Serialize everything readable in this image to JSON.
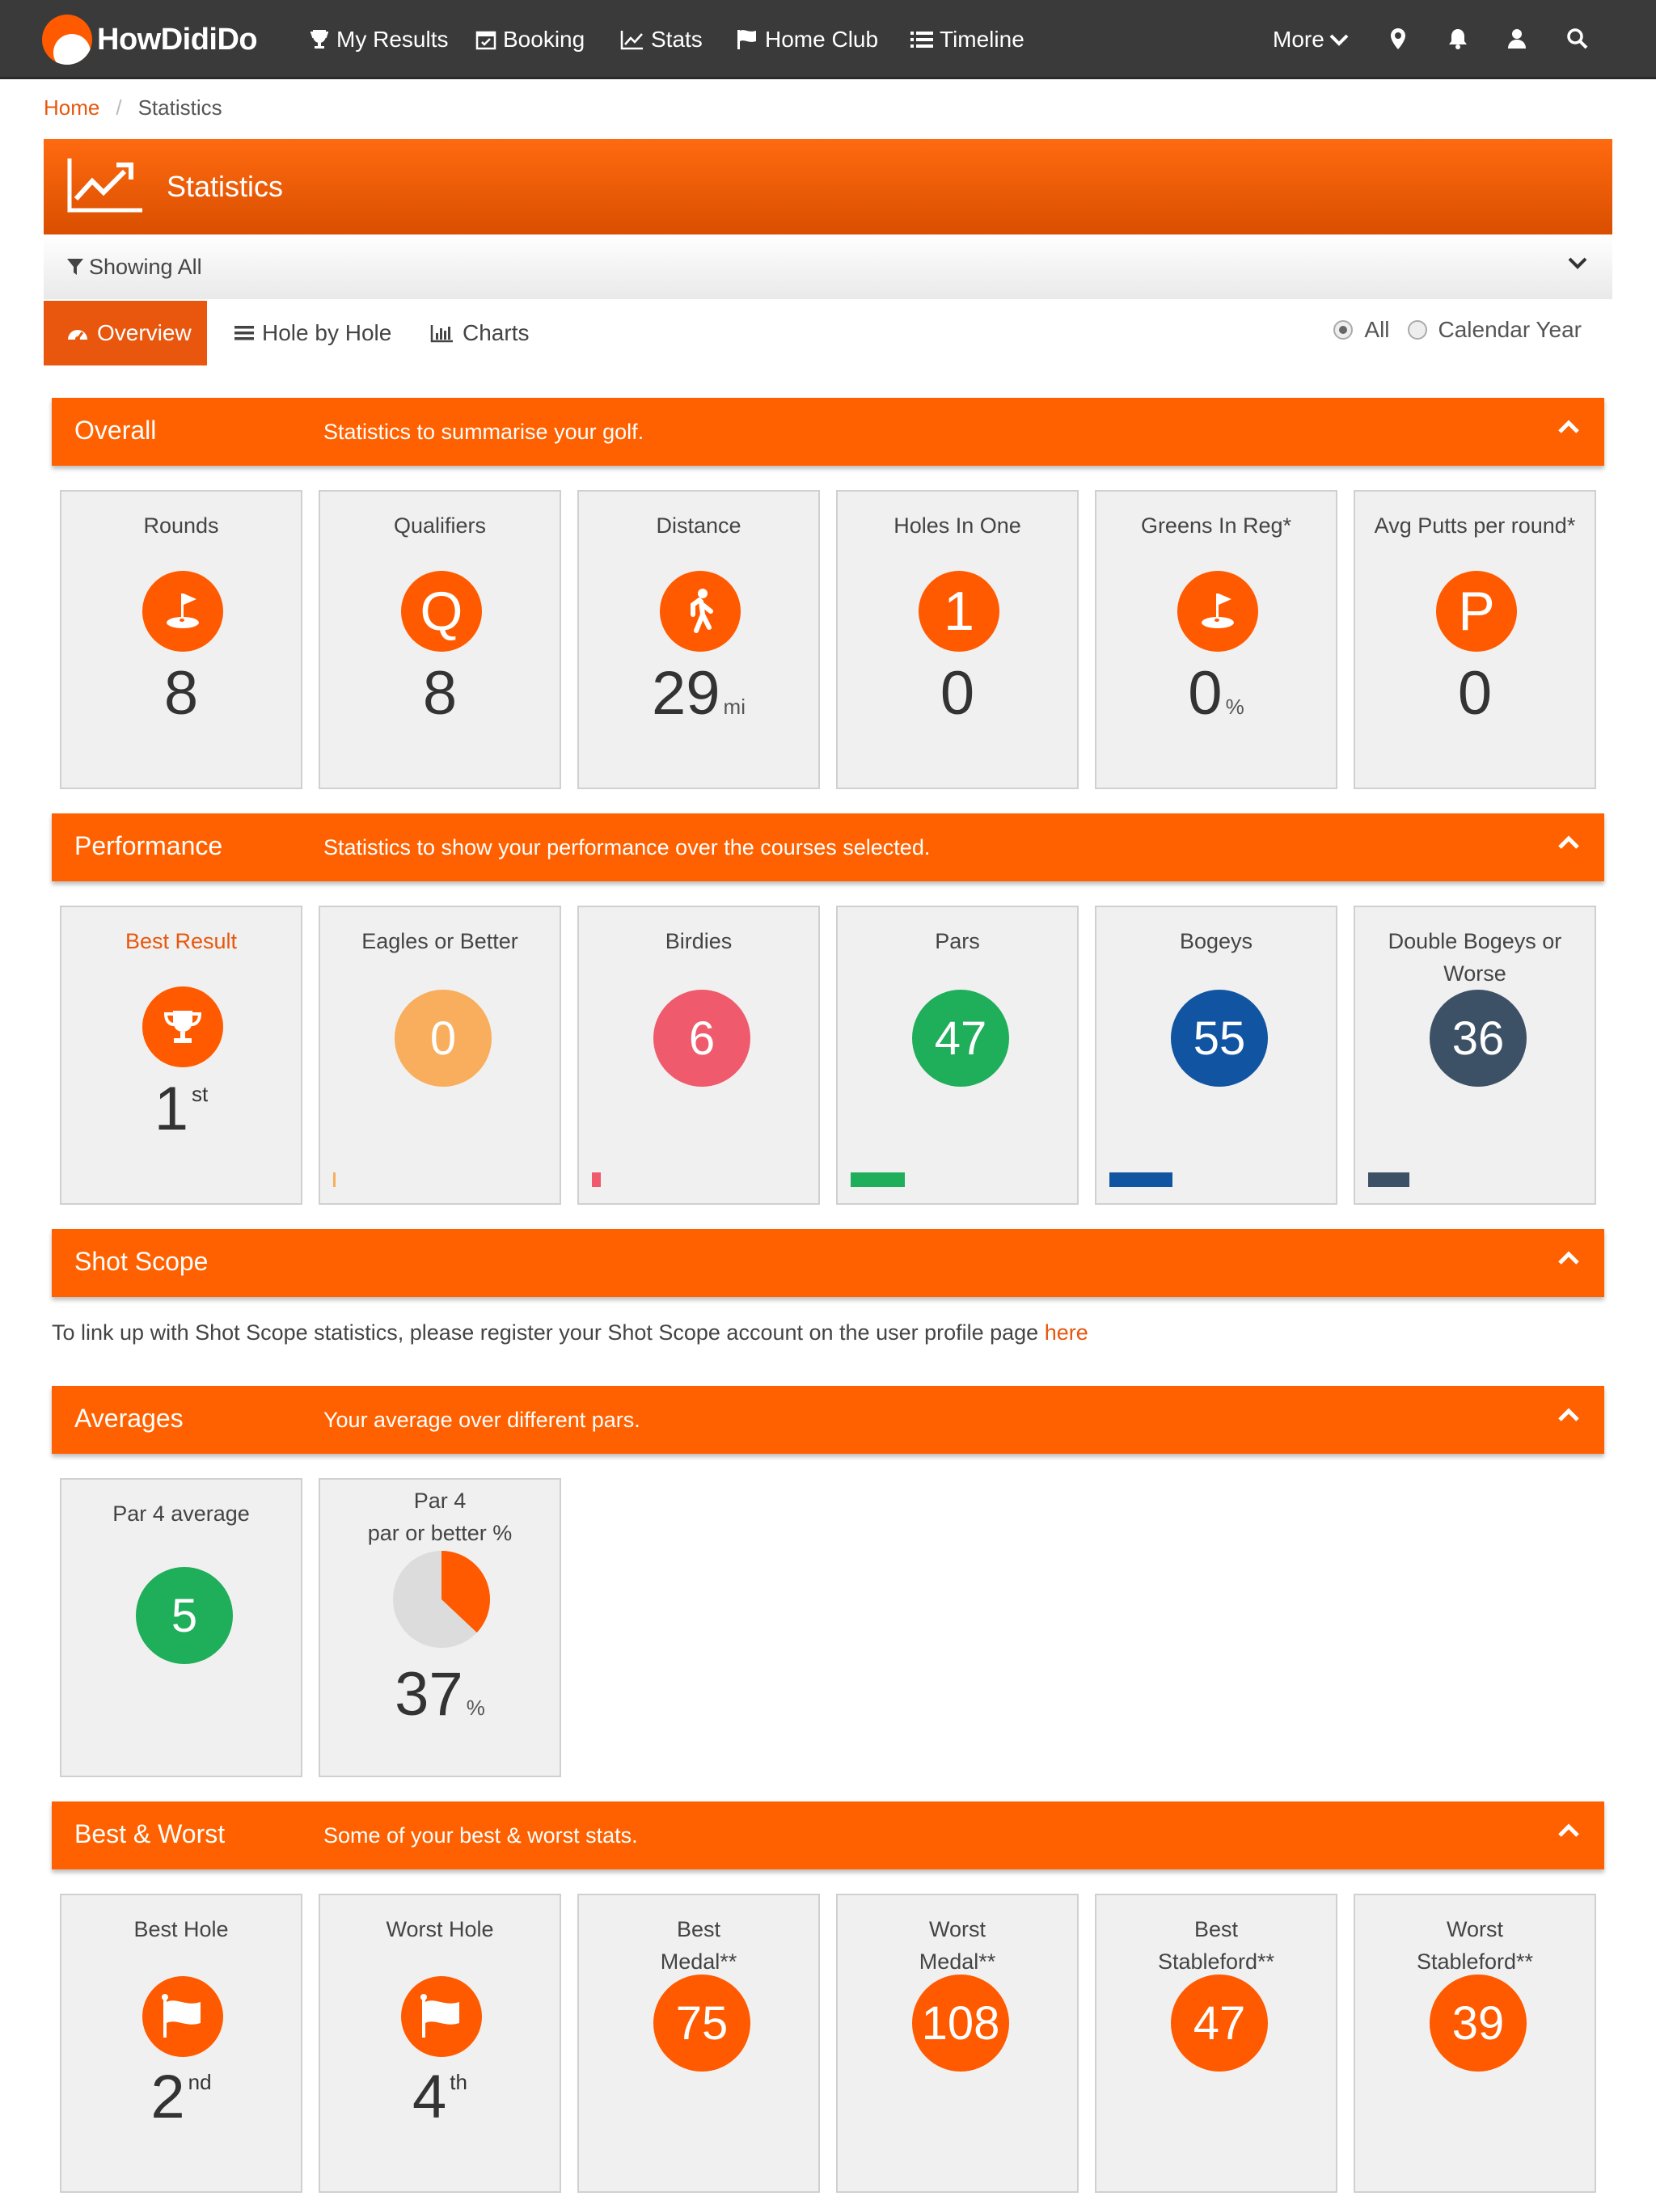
{
  "app": {
    "brand": "HowDidiDo",
    "accent_color": "#ff6100"
  },
  "nav": {
    "items": [
      {
        "label": "My Results",
        "icon": "trophy-icon"
      },
      {
        "label": "Booking",
        "icon": "calendar-icon"
      },
      {
        "label": "Stats",
        "icon": "line-chart-icon"
      },
      {
        "label": "Home Club",
        "icon": "flag-icon"
      },
      {
        "label": "Timeline",
        "icon": "list-icon"
      }
    ],
    "more_label": "More",
    "right_icons": [
      "map-marker-icon",
      "bell-icon",
      "user-icon",
      "search-icon"
    ]
  },
  "breadcrumb": {
    "home": "Home",
    "current": "Statistics"
  },
  "header": {
    "title": "Statistics",
    "filter_label": "Showing All"
  },
  "tabs": {
    "overview": "Overview",
    "hole_by_hole": "Hole by Hole",
    "charts": "Charts",
    "radio_all": "All",
    "radio_calendar": "Calendar Year",
    "selected_radio": "All"
  },
  "sections": {
    "overall": {
      "title": "Overall",
      "description": "Statistics to summarise your golf.",
      "cards": {
        "rounds": {
          "label": "Rounds",
          "value": "8",
          "icon": "golf-flag-icon"
        },
        "qualifiers": {
          "label": "Qualifiers",
          "value": "8",
          "icon_letter": "Q"
        },
        "distance": {
          "label": "Distance",
          "value": "29",
          "unit": "mi",
          "icon": "walking-icon"
        },
        "holes_in_one": {
          "label": "Holes In One",
          "value": "0",
          "icon_letter": "1"
        },
        "greens_in_reg": {
          "label": "Greens In Reg*",
          "value": "0",
          "unit": "%",
          "icon": "golf-flag-icon"
        },
        "avg_putts": {
          "label": "Avg Putts per round*",
          "value": "0",
          "icon_letter": "P"
        }
      }
    },
    "performance": {
      "title": "Performance",
      "description": "Statistics to show your performance over the courses selected.",
      "best_result": {
        "label": "Best Result",
        "value": "1",
        "suffix": "st",
        "icon": "trophy-icon"
      },
      "scores": {
        "eagles": {
          "label": "Eagles or Better",
          "value": "0",
          "color": "#f8ae5c",
          "bar_fraction": 0.01
        },
        "birdies": {
          "label": "Birdies",
          "value": "6",
          "color": "#ef5b6c",
          "bar_fraction": 0.04
        },
        "pars": {
          "label": "Pars",
          "value": "47",
          "color": "#1fae5a",
          "bar_fraction": 0.25
        },
        "bogeys": {
          "label": "Bogeys",
          "value": "55",
          "color": "#1155a2",
          "bar_fraction": 0.29
        },
        "double_bogeys": {
          "label": "Double Bogeys or Worse",
          "value": "36",
          "color": "#3d5166",
          "bar_fraction": 0.19
        }
      }
    },
    "shot_scope": {
      "title": "Shot Scope",
      "info": "To link up with Shot Scope statistics, please register your Shot Scope account on the user profile page",
      "link": "here"
    },
    "averages": {
      "title": "Averages",
      "description": "Your average over different pars.",
      "par4_average": {
        "label": "Par 4 average",
        "value": "5",
        "color": "#1fae5a"
      },
      "par4_par_or_better": {
        "label_line1": "Par 4",
        "label_line2": "par or better %",
        "value": "37",
        "unit": "%",
        "fraction": 0.37
      }
    },
    "best_worst": {
      "title": "Best & Worst",
      "description": "Some of your best & worst stats.",
      "best_hole": {
        "label": "Best Hole",
        "value": "2",
        "suffix": "nd",
        "icon": "white-flag-icon"
      },
      "worst_hole": {
        "label": "Worst Hole",
        "value": "4",
        "suffix": "th",
        "icon": "white-flag-icon"
      },
      "best_medal": {
        "label_line1": "Best",
        "label_line2": "Medal**",
        "value": "75"
      },
      "worst_medal": {
        "label_line1": "Worst",
        "label_line2": "Medal**",
        "value": "108"
      },
      "best_stableford": {
        "label_line1": "Best",
        "label_line2": "Stableford**",
        "value": "47"
      },
      "worst_stableford": {
        "label_line1": "Worst",
        "label_line2": "Stableford**",
        "value": "39"
      }
    }
  }
}
